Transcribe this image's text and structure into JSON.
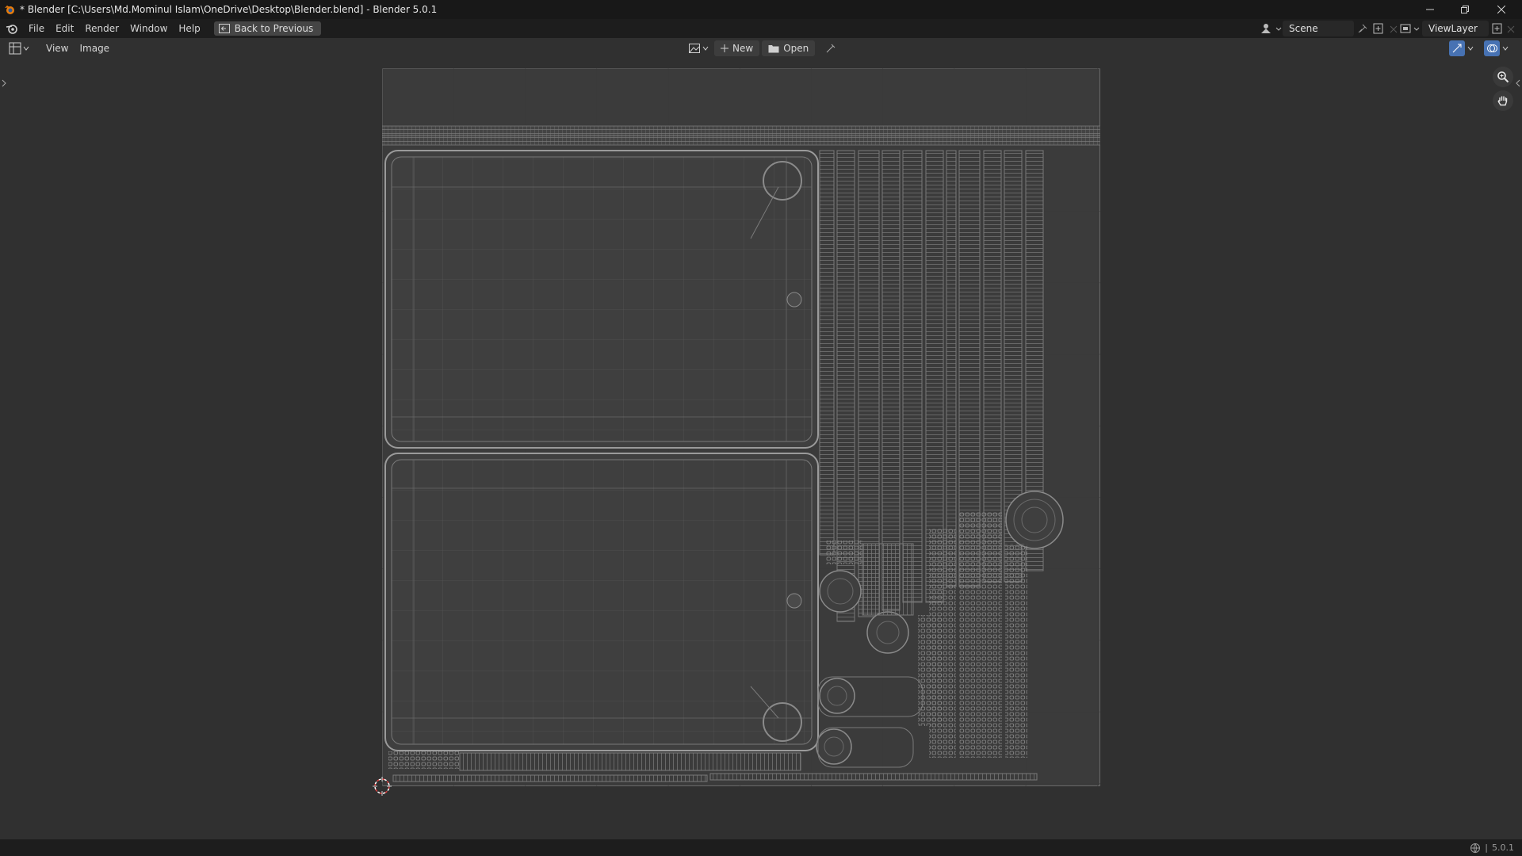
{
  "window": {
    "title": "* Blender [C:\\Users\\Md.Mominul Islam\\OneDrive\\Desktop\\Blender.blend] - Blender 5.0.1"
  },
  "topbar": {
    "menus": [
      "File",
      "Edit",
      "Render",
      "Window",
      "Help"
    ],
    "back_button": "Back to Previous",
    "scene_name": "Scene",
    "view_layer_name": "ViewLayer"
  },
  "editor_header": {
    "menus": [
      "View",
      "Image"
    ],
    "new_label": "New",
    "open_label": "Open"
  },
  "status": {
    "version": "5.0.1"
  },
  "colors": {
    "uv_wire": "#8c8c8c",
    "background": "#303030",
    "header": "#1d1d1d",
    "cursor_red": "#e04040"
  }
}
